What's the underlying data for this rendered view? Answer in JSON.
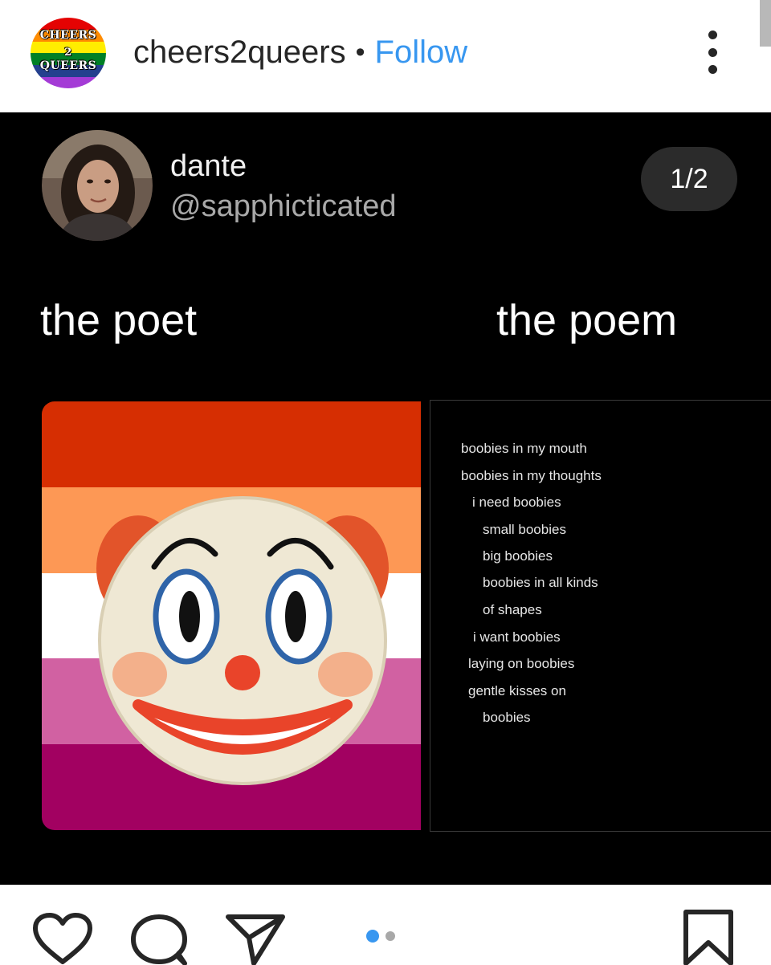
{
  "header": {
    "logo_line1": "CHEERS",
    "logo_line2": "2",
    "logo_line3": "QUEERS",
    "username": "cheers2queers",
    "separator": "•",
    "follow_label": "Follow"
  },
  "post": {
    "display_name": "dante",
    "handle": "@sapphicticated",
    "counter": "1/2",
    "label_left": "the poet",
    "label_right": "the poem",
    "flag_colors": [
      "#d62e02",
      "#fd9855",
      "#ffffff",
      "#d161a2",
      "#a20161"
    ],
    "poem_lines": [
      "boobies in my mouth",
      "boobies in my thoughts",
      "i need boobies",
      "small boobies",
      "big boobies",
      "boobies in all kinds",
      "of shapes",
      "i want boobies",
      "laying on boobies",
      "gentle kisses on",
      "boobies"
    ]
  },
  "actions": {
    "icons": [
      "heart-icon",
      "comment-icon",
      "share-icon",
      "bookmark-icon"
    ],
    "carousel": {
      "current": 1,
      "total": 2
    },
    "active_dot_color": "#3897f0",
    "inactive_dot_color": "#a8a8a8"
  }
}
